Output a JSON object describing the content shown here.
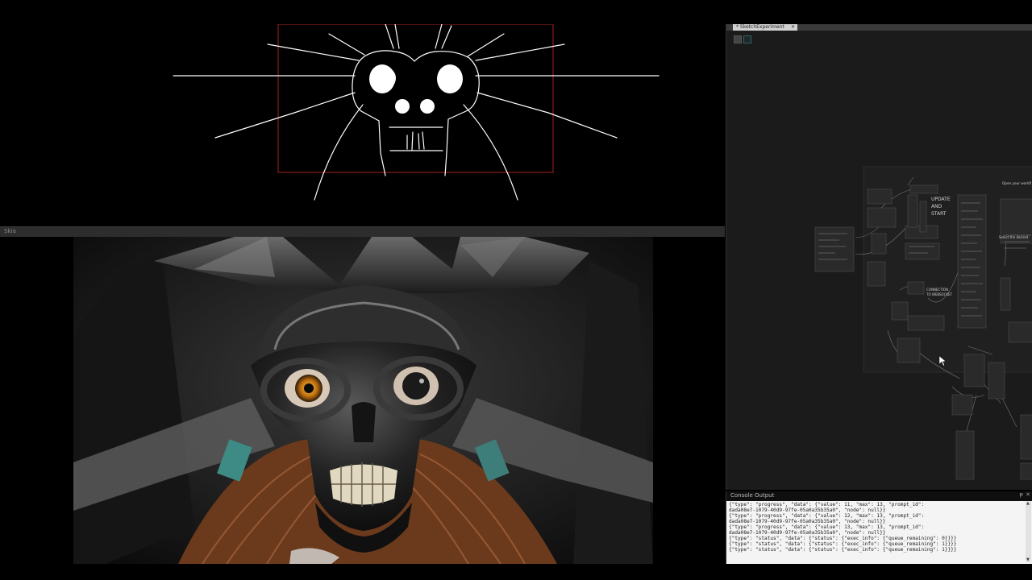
{
  "editor": {
    "tab_title": "* SketchExperiment",
    "tab_close": "✕",
    "toolbar": {
      "btn_a": "toolbar-button",
      "btn_b": "toolbar-button"
    }
  },
  "output_bar": {
    "label": "Skia"
  },
  "node_graph": {
    "update_label_lines": [
      "UPDATE",
      "AND",
      "START"
    ],
    "connection_label_lines": [
      "CONNECTION",
      "TO WEBSOCKET"
    ],
    "open_workflow_text": "Open your workfl",
    "select_desired_text": "Select the desired"
  },
  "console": {
    "title": "Console Output",
    "pin_icon": "pin-icon",
    "close_icon": "close-icon",
    "lines": [
      "{\"type\": \"progress\", \"data\": {\"value\": 11, \"max\": 13, \"prompt_id\":",
      "dada08e7-1079-40d9-97fe-05a0a35b35a0\", \"node\": null}}",
      "{\"type\": \"progress\", \"data\": {\"value\": 12, \"max\": 13, \"prompt_id\":",
      "dada08e7-1079-40d9-97fe-05a0a35b35a0\", \"node\": null}}",
      "{\"type\": \"progress\", \"data\": {\"value\": 13, \"max\": 13, \"prompt_id\":",
      "dada08e7-1079-40d9-97fe-05a0a35b35a0\", \"node\": null}}",
      "{\"type\": \"status\", \"data\": {\"status\": {\"exec_info\": {\"queue_remaining\": 0}}}}",
      "{\"type\": \"status\", \"data\": {\"status\": {\"exec_info\": {\"queue_remaining\": 1}}}}",
      "{\"type\": \"status\", \"data\": {\"status\": {\"exec_info\": {\"queue_remaining\": 1}}}}"
    ]
  },
  "colors": {
    "sketch_stroke": "#ffffff",
    "sketch_frame": "#8a1a1a",
    "eye_glow": "#e0a020"
  }
}
